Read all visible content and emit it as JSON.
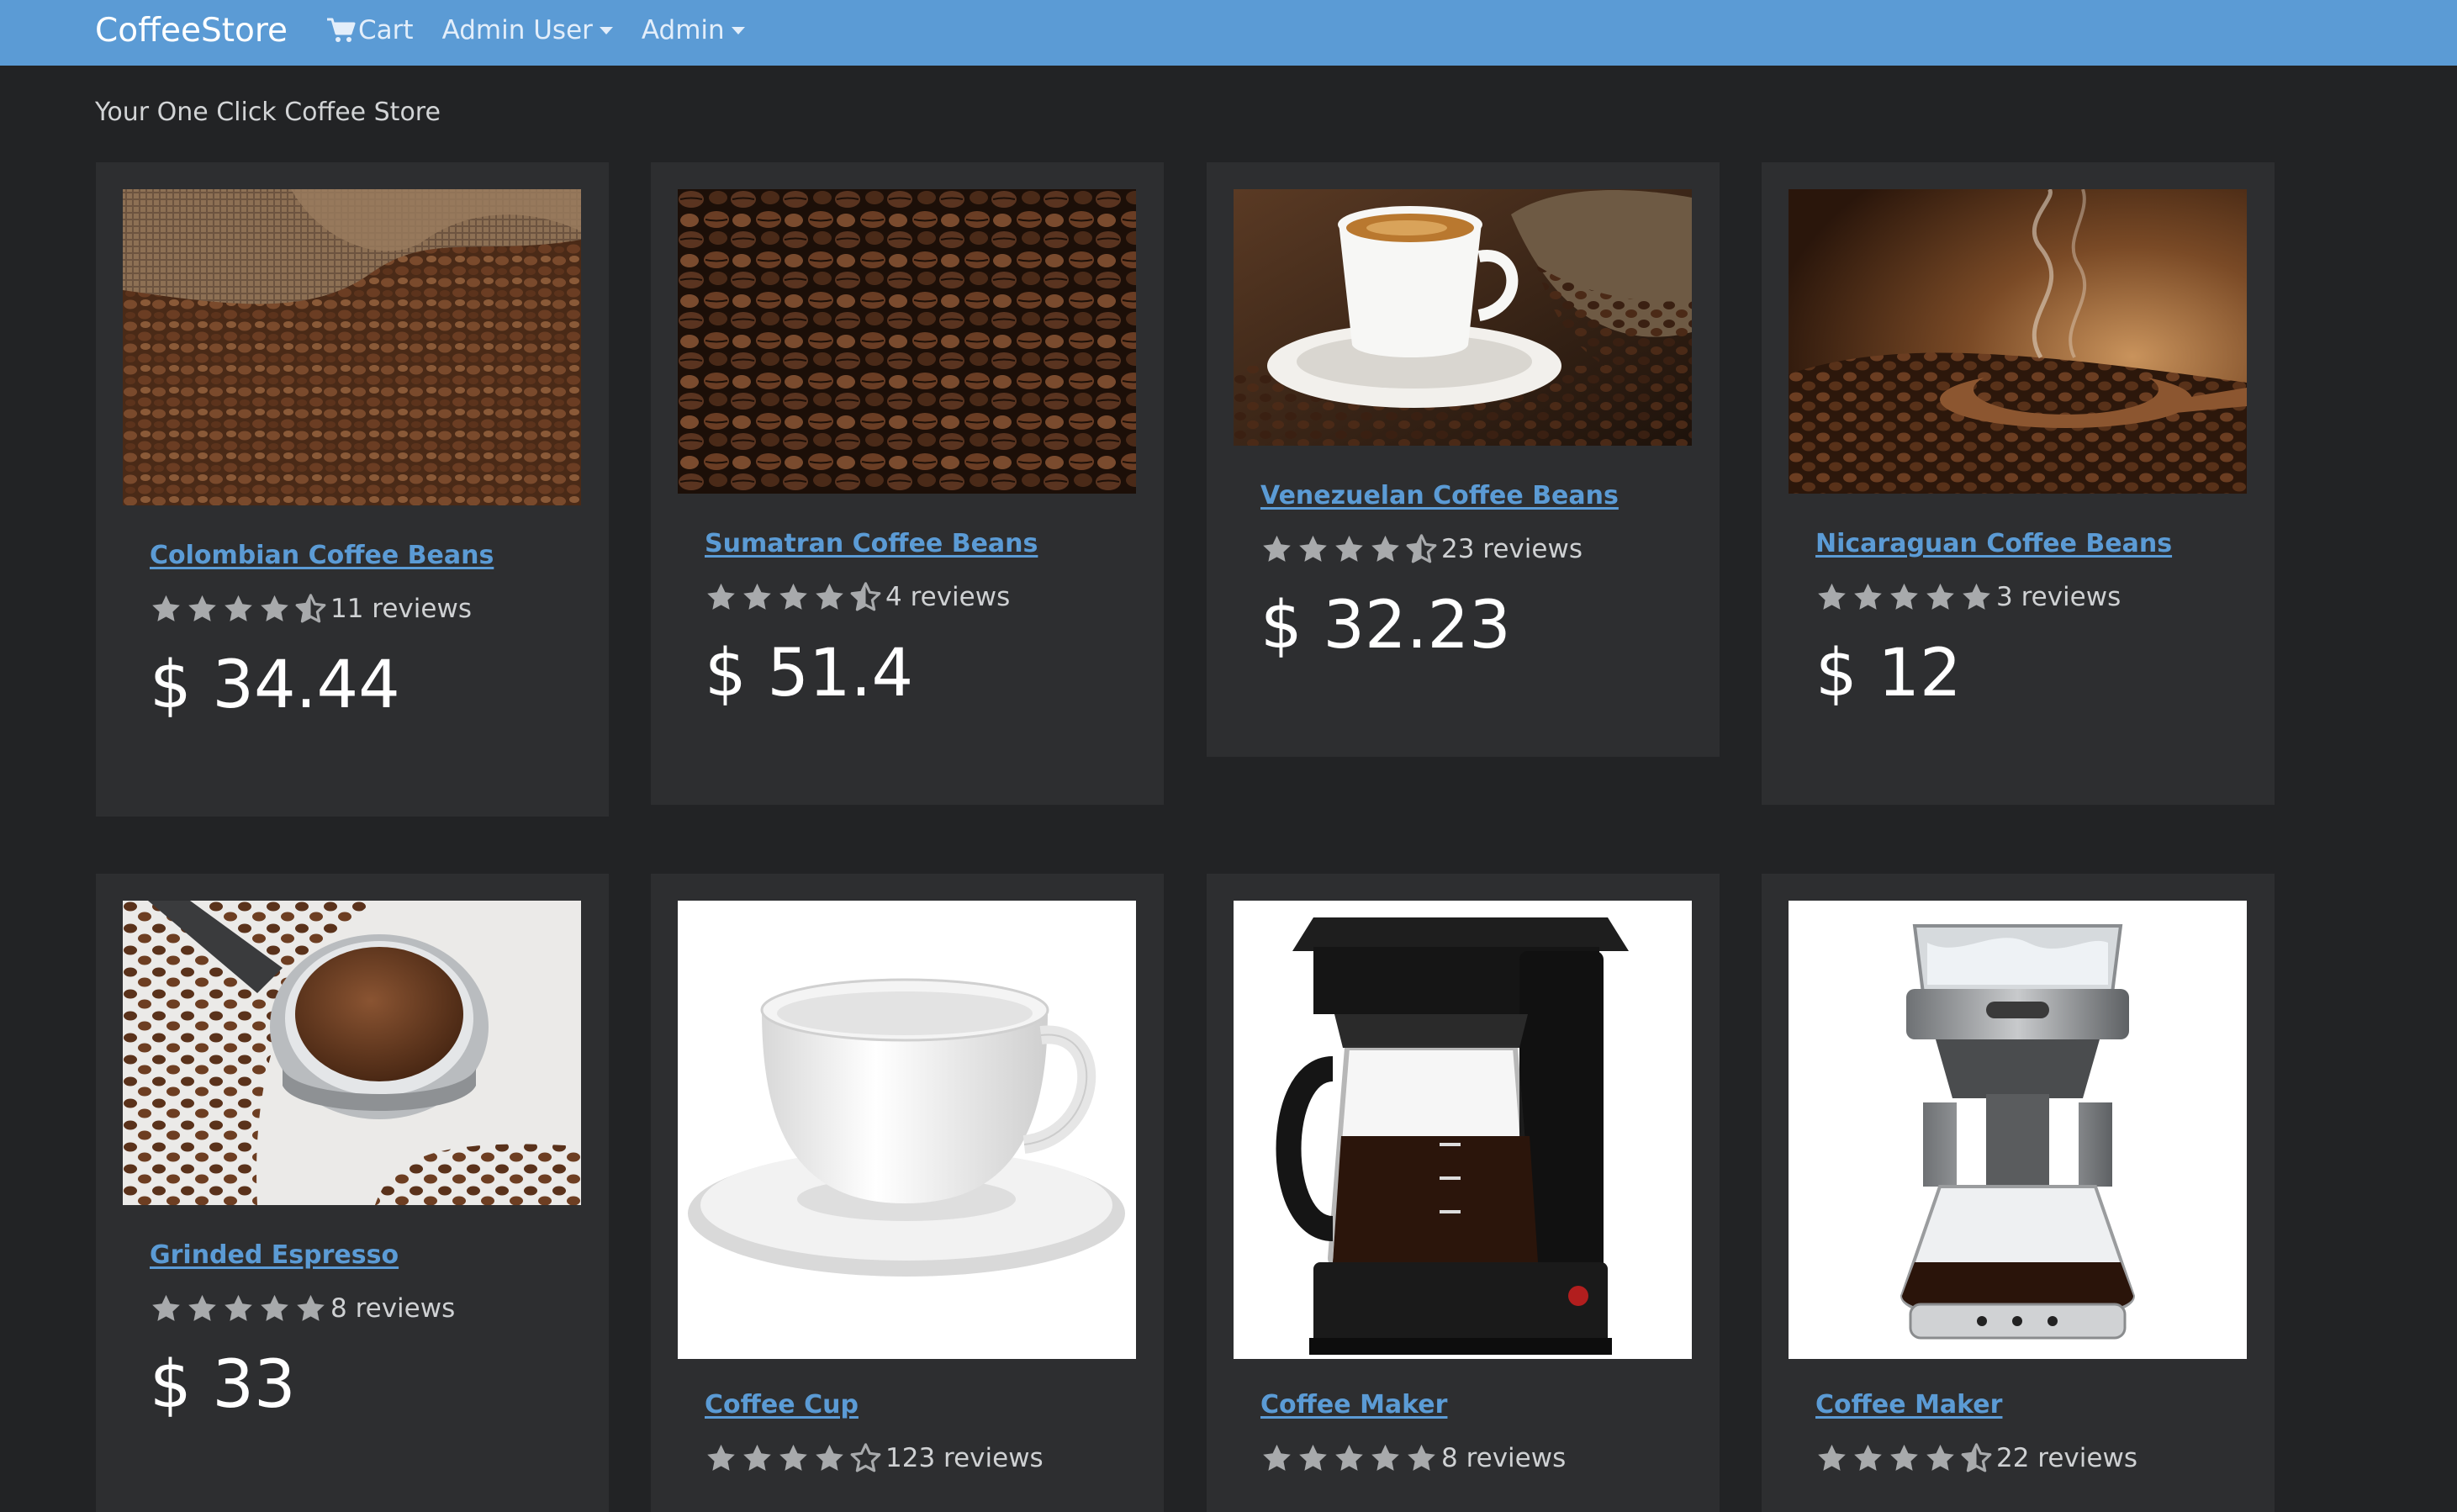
{
  "navbar": {
    "brand": "CoffeeStore",
    "cart_icon": "shopping-cart-icon",
    "cart_label": "Cart",
    "admin_user_label": "Admin User",
    "admin_label": "Admin"
  },
  "tagline": "Your One Click Coffee Store",
  "colors": {
    "navbar": "#5b9bd5",
    "background": "#222325",
    "card": "#2d2e30",
    "link": "#5b9bd5",
    "star": "#a8aaac"
  },
  "products": [
    {
      "title": "Colombian Coffee Beans",
      "rating": 4.5,
      "reviews": "11 reviews",
      "price": "$ 34.44",
      "image": "coffee-beans-burlap-sack"
    },
    {
      "title": "Sumatran Coffee Beans",
      "rating": 4.5,
      "reviews": "4 reviews",
      "price": "$ 51.4",
      "image": "coffee-beans-closeup"
    },
    {
      "title": "Venezuelan Coffee Beans",
      "rating": 4.5,
      "reviews": "23 reviews",
      "price": "$ 32.23",
      "image": "espresso-cup-with-beans"
    },
    {
      "title": "Nicaraguan Coffee Beans",
      "rating": 5,
      "reviews": "3 reviews",
      "price": "$ 12",
      "image": "steaming-beans-wooden-spoon"
    },
    {
      "title": "Grinded Espresso",
      "rating": 5,
      "reviews": "8 reviews",
      "price": "$ 33",
      "image": "ground-espresso-portafilter"
    },
    {
      "title": "Coffee Cup",
      "rating": 4,
      "reviews": "123 reviews",
      "price": "",
      "image": "white-cup-and-saucer"
    },
    {
      "title": "Coffee Maker",
      "rating": 5,
      "reviews": "8 reviews",
      "price": "",
      "image": "black-drip-coffee-maker"
    },
    {
      "title": "Coffee Maker",
      "rating": 4.5,
      "reviews": "22 reviews",
      "price": "",
      "image": "pour-over-coffee-maker"
    }
  ]
}
